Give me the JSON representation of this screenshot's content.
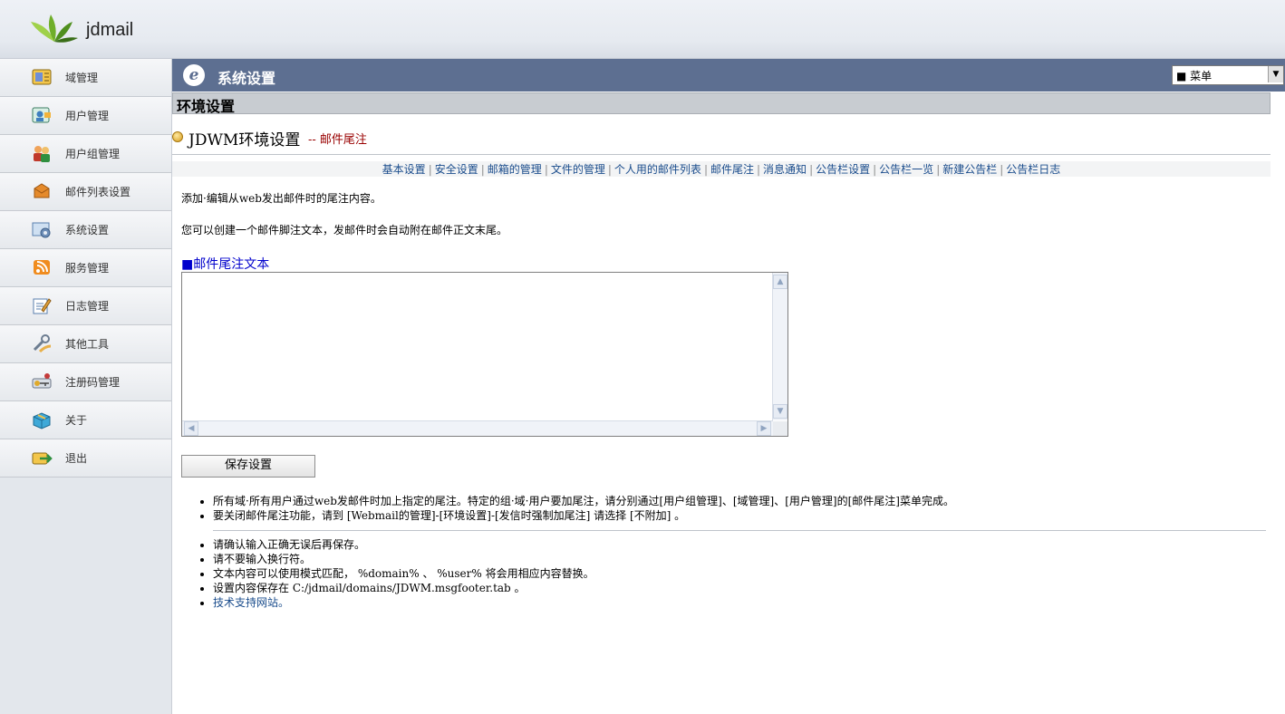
{
  "app": {
    "logo_text": "jdmail"
  },
  "sidebar": {
    "items": [
      {
        "label": "域管理",
        "icon": "domain-icon"
      },
      {
        "label": "用户管理",
        "icon": "user-icon"
      },
      {
        "label": "用户组管理",
        "icon": "user-group-icon"
      },
      {
        "label": "邮件列表设置",
        "icon": "mailing-list-icon"
      },
      {
        "label": "系统设置",
        "icon": "system-settings-icon"
      },
      {
        "label": "服务管理",
        "icon": "service-icon"
      },
      {
        "label": "日志管理",
        "icon": "log-icon"
      },
      {
        "label": "其他工具",
        "icon": "tools-icon"
      },
      {
        "label": "注册码管理",
        "icon": "license-icon"
      },
      {
        "label": "关于",
        "icon": "about-icon"
      },
      {
        "label": "退出",
        "icon": "logout-icon"
      }
    ]
  },
  "header": {
    "title": "系统设置",
    "menu_select": "■ 菜单"
  },
  "section": {
    "title": "环境设置"
  },
  "page": {
    "title": "JDWM环境设置",
    "subtitle": "-- 邮件尾注"
  },
  "tabs": [
    "基本设置",
    "安全设置",
    "邮箱的管理",
    "文件的管理",
    "个人用的邮件列表",
    "邮件尾注",
    "消息通知",
    "公告栏设置",
    "公告栏一览",
    "新建公告栏",
    "公告栏日志"
  ],
  "content": {
    "para1": "添加·编辑从web发出邮件时的尾注内容。",
    "para2": "您可以创建一个邮件脚注文本，发邮件时会自动附在邮件正文末尾。",
    "field_label": "■邮件尾注文本",
    "textarea_value": "",
    "save_button": "保存设置"
  },
  "notes1": [
    "所有域·所有用户通过web发邮件时加上指定的尾注。特定的组·域·用户要加尾注，请分别通过[用户组管理]、[域管理]、[用户管理]的[邮件尾注]菜单完成。",
    "要关闭邮件尾注功能，请到 [Webmail的管理]-[环境设置]-[发信时强制加尾注] 请选择 [不附加] 。"
  ],
  "notes2": [
    "请确认输入正确无误后再保存。",
    "请不要输入换行符。",
    "文本内容可以使用模式匹配， %domain% 、 %user% 将会用相应内容替换。",
    "设置内容保存在 C:/jdmail/domains/JDWM.msgfooter.tab 。"
  ],
  "support_link": "技术支持网站。",
  "colors": {
    "header_bg": "#5d6f91",
    "link": "#1a4c8c",
    "subtitle": "#990000"
  }
}
